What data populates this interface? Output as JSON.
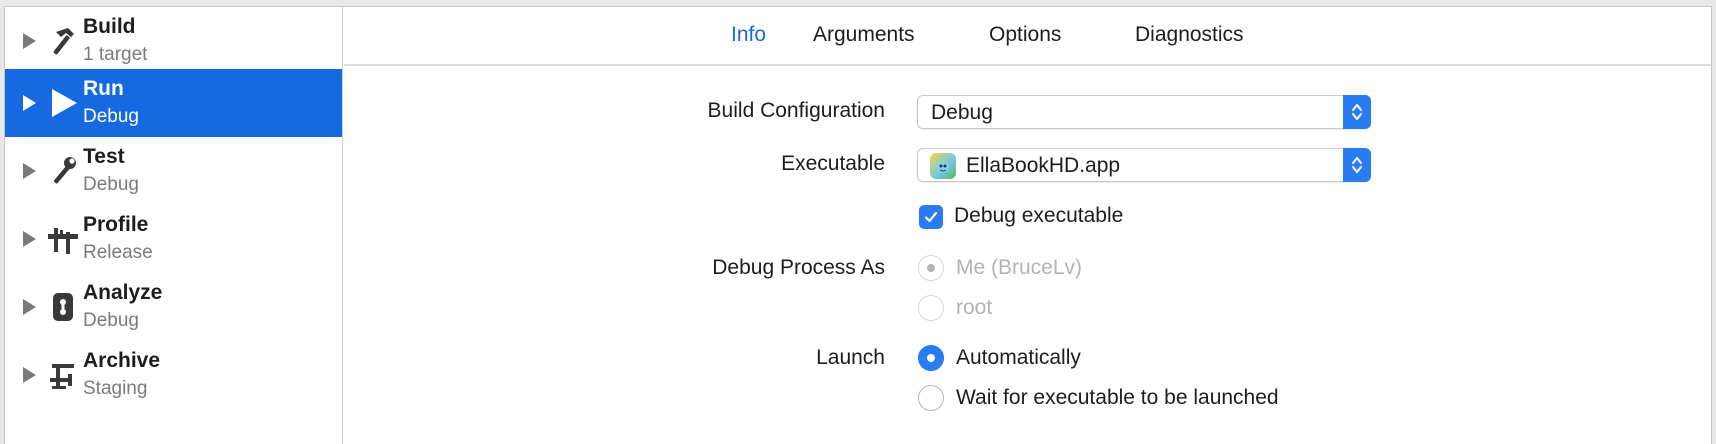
{
  "sidebar": {
    "items": [
      {
        "title": "Build",
        "subtitle": "1 target",
        "icon": "hammer-icon"
      },
      {
        "title": "Run",
        "subtitle": "Debug",
        "icon": "play-icon"
      },
      {
        "title": "Test",
        "subtitle": "Debug",
        "icon": "wrench-icon"
      },
      {
        "title": "Profile",
        "subtitle": "Release",
        "icon": "instruments-icon"
      },
      {
        "title": "Analyze",
        "subtitle": "Debug",
        "icon": "analyze-icon"
      },
      {
        "title": "Archive",
        "subtitle": "Staging",
        "icon": "archive-icon"
      }
    ],
    "selected_index": 1
  },
  "tabs": [
    {
      "label": "Info",
      "active": true
    },
    {
      "label": "Arguments",
      "active": false
    },
    {
      "label": "Options",
      "active": false
    },
    {
      "label": "Diagnostics",
      "active": false
    }
  ],
  "form": {
    "build_configuration": {
      "label": "Build Configuration",
      "value": "Debug"
    },
    "executable": {
      "label": "Executable",
      "value": "EllaBookHD.app",
      "icon": "app-icon"
    },
    "debug_executable": {
      "label": "Debug executable",
      "checked": true
    },
    "debug_process_as": {
      "label": "Debug Process As",
      "options": [
        {
          "label": "Me (BruceLv)",
          "selected": true,
          "enabled": false
        },
        {
          "label": "root",
          "selected": false,
          "enabled": false
        }
      ]
    },
    "launch": {
      "label": "Launch",
      "options": [
        {
          "label": "Automatically",
          "selected": true
        },
        {
          "label": "Wait for executable to be launched",
          "selected": false
        }
      ]
    }
  },
  "colors": {
    "accent": "#1669e0",
    "control_blue": "#2a7cf2",
    "disabled_text": "#b3b3b3",
    "secondary_text": "#7b7b7b"
  }
}
